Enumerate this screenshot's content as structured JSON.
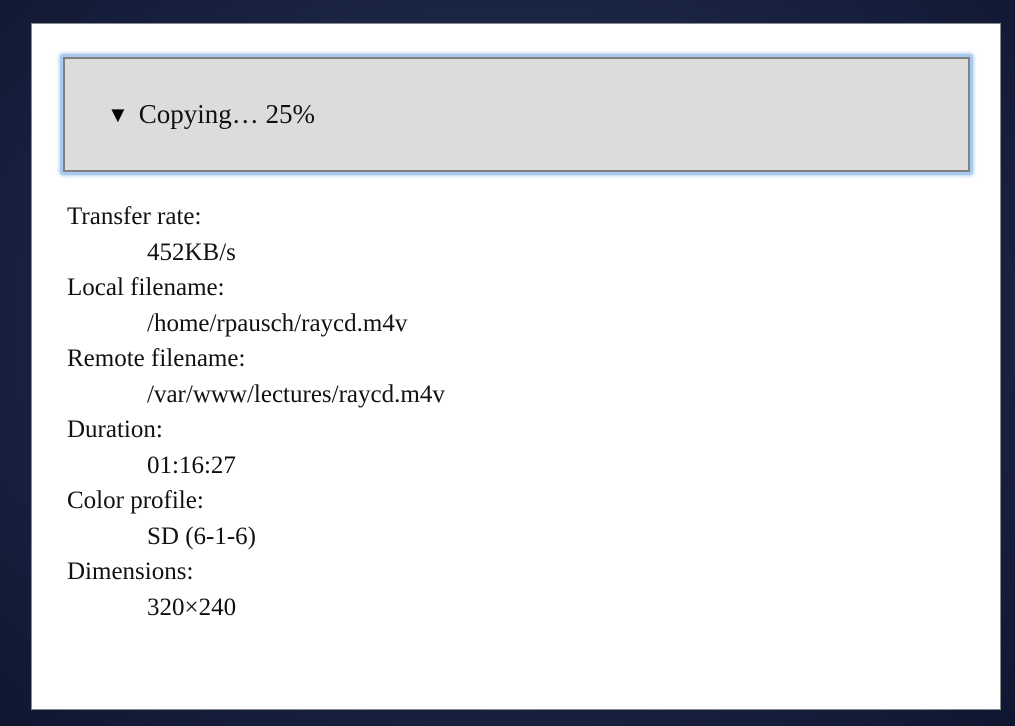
{
  "transfer": {
    "summary_label": "Copying… 25%",
    "progress_percent": 25,
    "expanded": true,
    "details": [
      {
        "label": "Transfer rate:",
        "value": "452KB/s"
      },
      {
        "label": "Local filename:",
        "value": "/home/rpausch/raycd.m4v"
      },
      {
        "label": "Remote filename:",
        "value": "/var/www/lectures/raycd.m4v"
      },
      {
        "label": "Duration:",
        "value": "01:16:27"
      },
      {
        "label": "Color profile:",
        "value": "SD (6-1-6)"
      },
      {
        "label": "Dimensions:",
        "value": "320×240"
      }
    ]
  },
  "colors": {
    "summary_background": "#dcdcdc",
    "focus_ring": "#a9c9ee",
    "page_background": "#1b2545"
  },
  "icons": {
    "disclosure": "disclosure-triangle-down-icon"
  }
}
